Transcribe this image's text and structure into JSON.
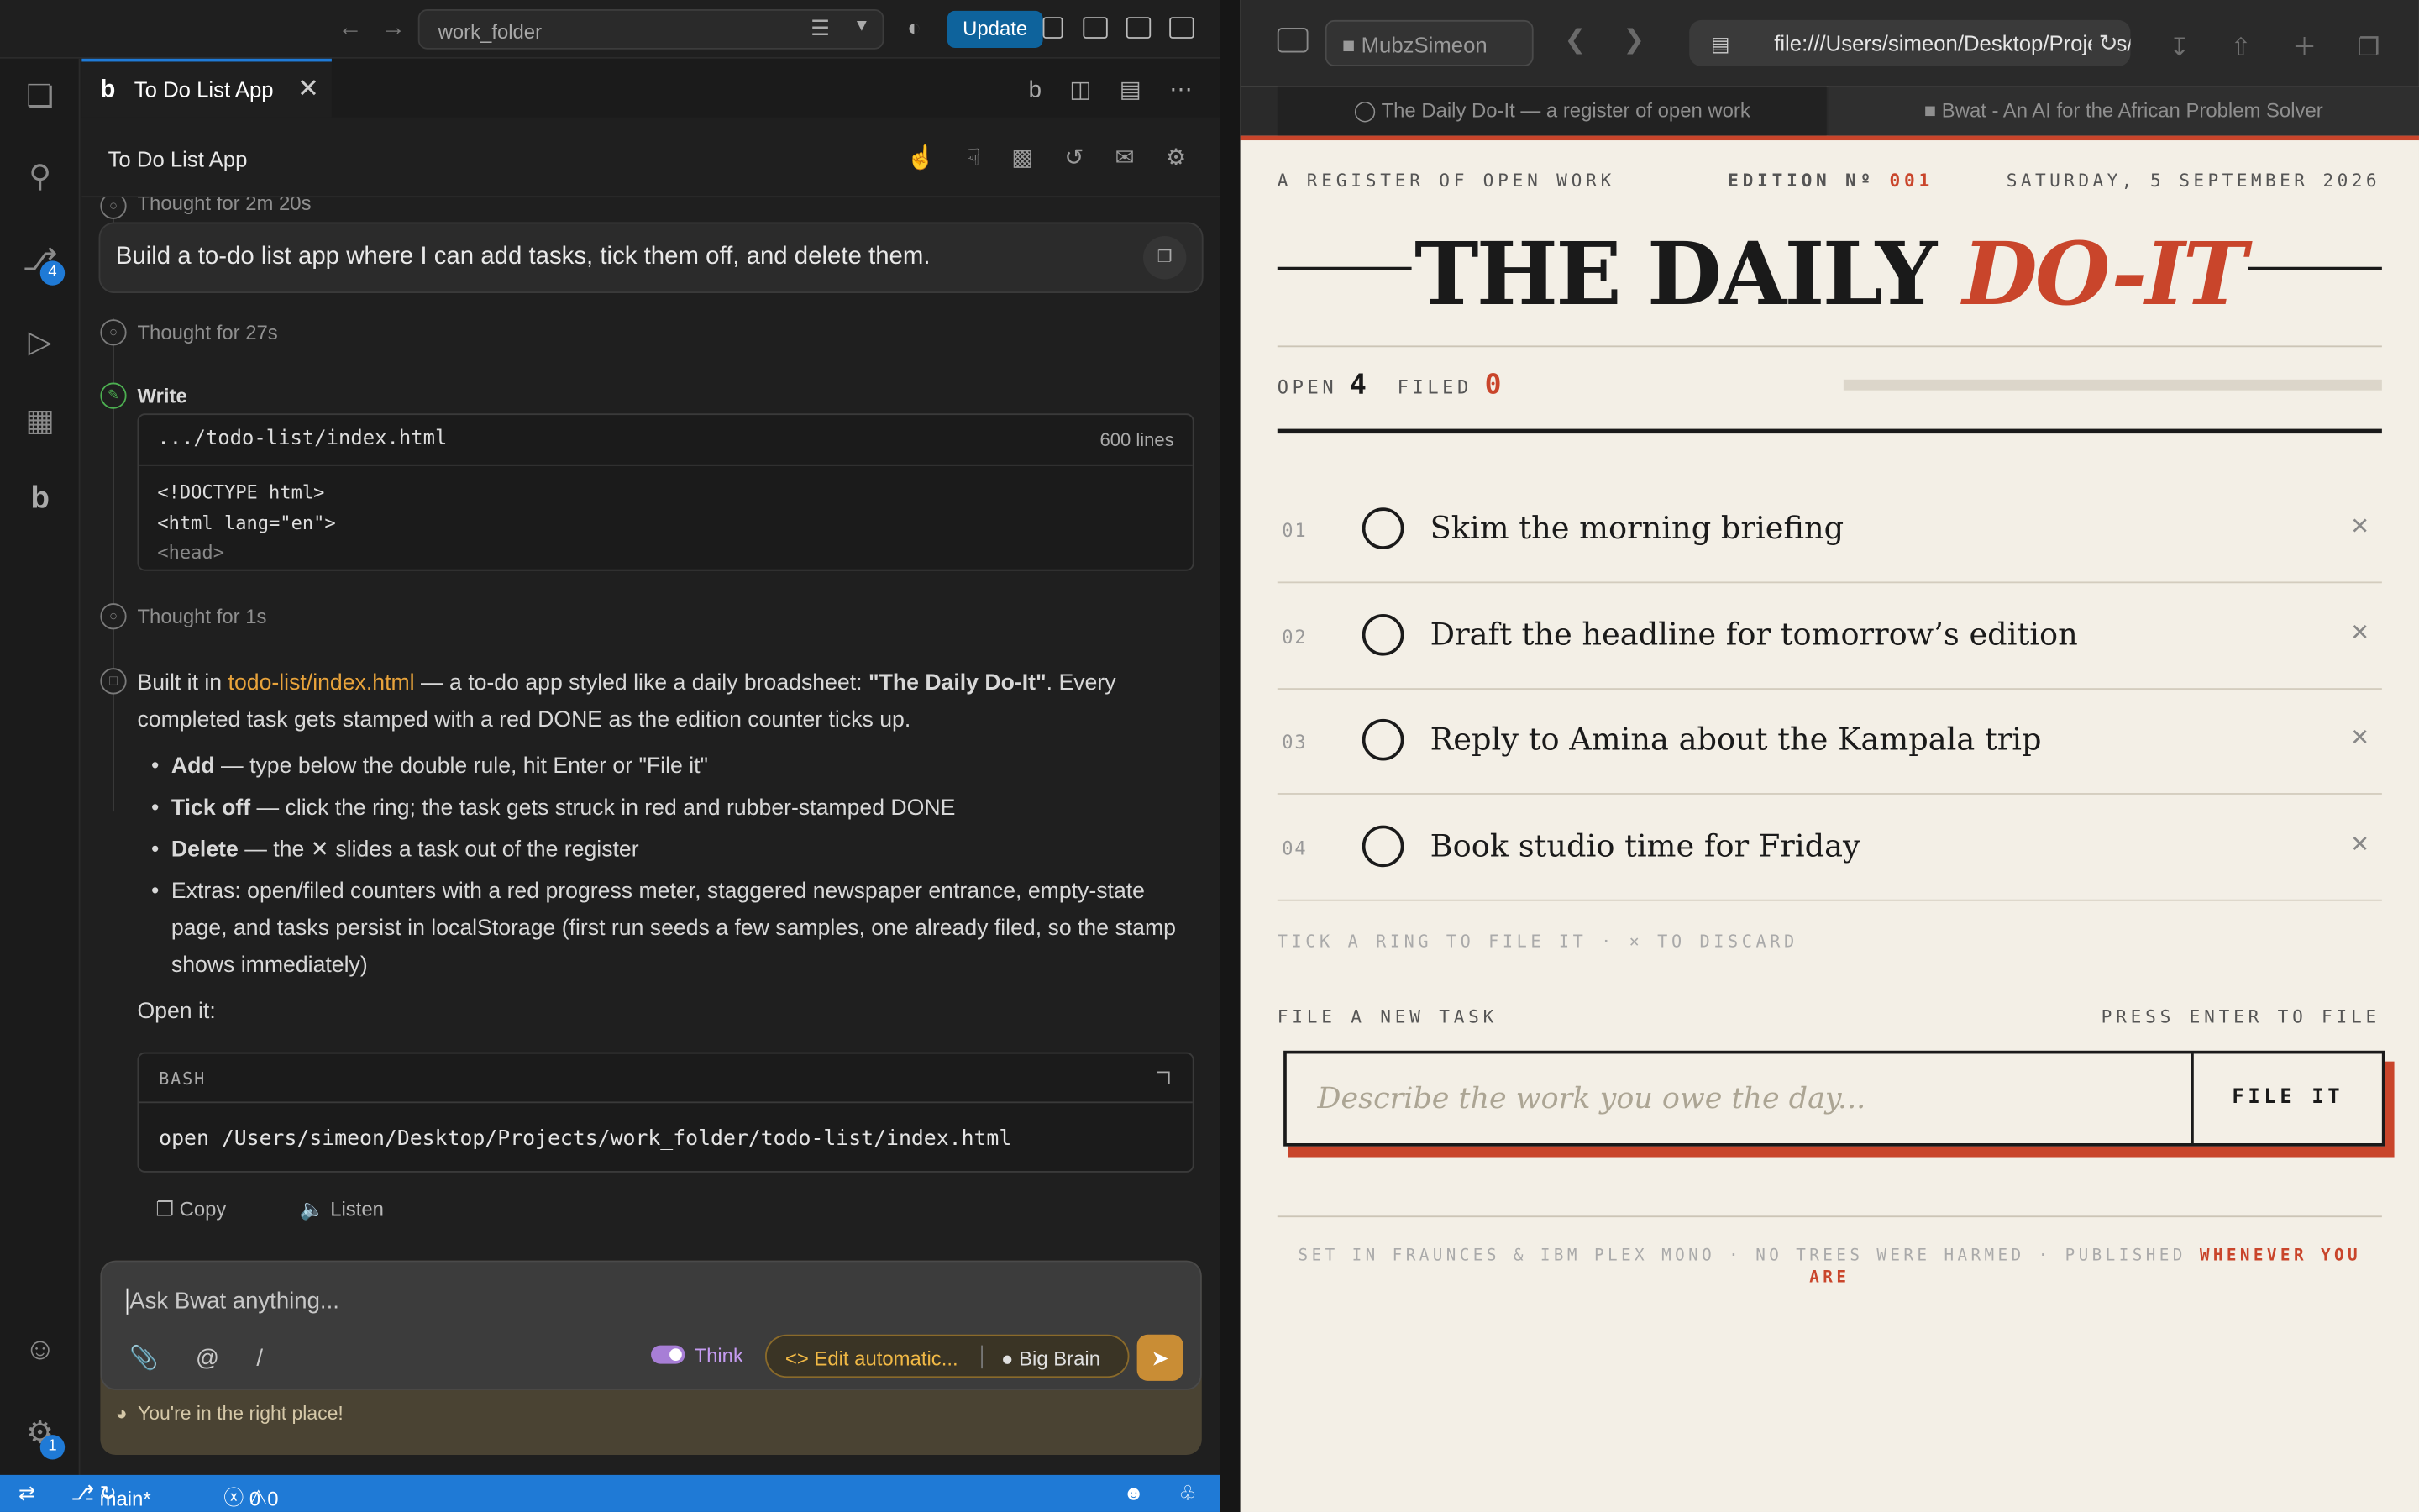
{
  "vscode": {
    "workspace": "work_folder",
    "update_label": "Update",
    "tab_title": "To Do List App",
    "panel_title": "To Do List App",
    "thought_top": "Thought for 2m 20s",
    "prompt": "Build a to-do list app where I can add tasks, tick them off, and delete them.",
    "thought1": "Thought for 27s",
    "write_label": "Write",
    "file_path": ".../todo-list/index.html",
    "file_lines": "600 lines",
    "code_lines": [
      "<!DOCTYPE html>",
      "<html lang=\"en\">",
      "<head>"
    ],
    "thought2": "Thought for 1s",
    "msg_pre": "Built it in ",
    "msg_link": "todo-list/index.html",
    "msg_mid": " — a to-do app styled like a daily broadsheet: ",
    "msg_bold": "\"The Daily Do-It\"",
    "msg_post": ". Every completed task gets stamped with a red DONE as the edition counter ticks up.",
    "bullets": [
      {
        "b": "Add",
        "t": " — type below the double rule, hit Enter or \"File it\""
      },
      {
        "b": "Tick off",
        "t": " — click the ring; the task gets struck in red and rubber-stamped DONE"
      },
      {
        "b": "Delete",
        "t": " — the ✕ slides a task out of the register"
      },
      {
        "b": "",
        "t": "Extras: open/filed counters with a red progress meter, staggered newspaper entrance, empty-state page, and tasks persist in localStorage (first run seeds a few samples, one already filed, so the stamp shows immediately)"
      }
    ],
    "open_it": "Open it:",
    "bash_label": "BASH",
    "bash_cmd": "open /Users/simeon/Desktop/Projects/work_folder/todo-list/index.html",
    "copy_label": "Copy",
    "listen_label": "Listen",
    "input_placeholder": "Ask Bwat anything...",
    "think_label": "Think",
    "edit_label": "Edit automatic...",
    "brain_label": "Big Brain",
    "hint": "You're in the right place!",
    "scm_badge": "4",
    "settings_badge": "1",
    "branch": "main*",
    "errors": "0",
    "warnings": "0"
  },
  "safari": {
    "profile": "MubzSimeon",
    "url": "file:///Users/simeon/Desktop/Projects/work_folder/todo-list/index.html",
    "tab1": "The Daily Do-It — a register of open work",
    "tab2": "Bwat - An AI for the African Problem Solver"
  },
  "paper": {
    "kicker": "A REGISTER OF OPEN WORK",
    "edition_label": "EDITION Nº",
    "edition_num": "001",
    "date": "SATURDAY, 5 SEPTEMBER 2026",
    "title_main": "THE DAILY ",
    "title_accent": "DO-IT",
    "open_label": "OPEN",
    "open_count": "4",
    "filed_label": "FILED",
    "filed_count": "0",
    "progress": 0,
    "tasks": [
      {
        "num": "01",
        "text": "Skim the morning briefing"
      },
      {
        "num": "02",
        "text": "Draft the headline for tomorrow’s edition"
      },
      {
        "num": "03",
        "text": "Reply to Amina about the Kampala trip"
      },
      {
        "num": "04",
        "text": "Book studio time for Friday"
      }
    ],
    "help": "TICK A RING TO FILE IT  ·  × TO DISCARD",
    "file_label": "FILE A NEW TASK",
    "file_hint": "PRESS ENTER TO FILE",
    "input_placeholder": "Describe the work you owe the day...",
    "file_button": "FILE IT",
    "footer": "SET IN FRAUNCES & IBM PLEX MONO · NO TREES WERE HARMED  ·  PUBLISHED ",
    "footer_accent": "WHENEVER YOU ARE"
  }
}
